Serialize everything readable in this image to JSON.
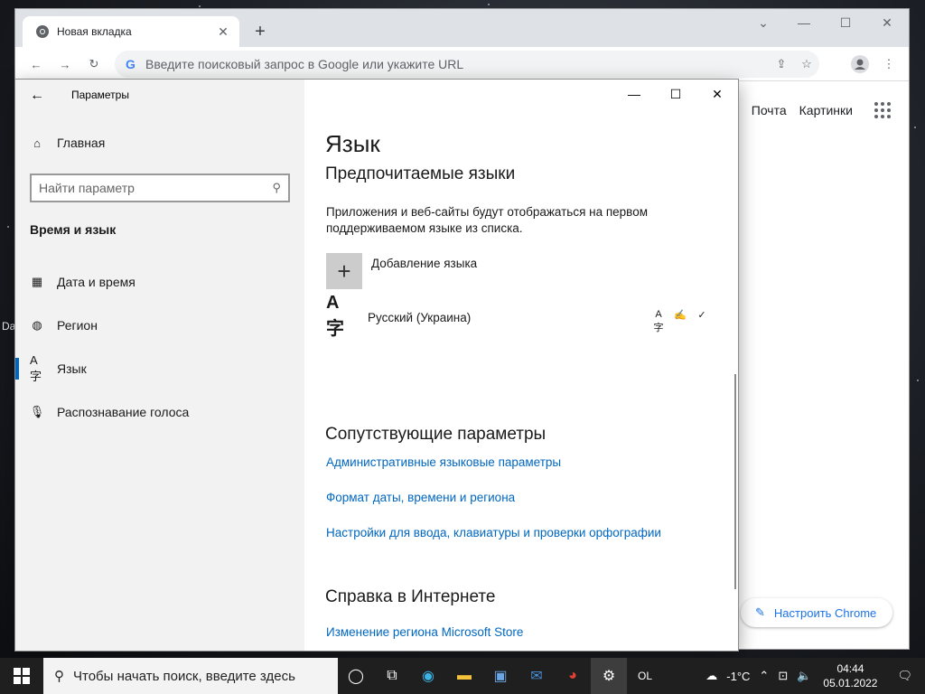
{
  "desktop": {
    "label": "Da"
  },
  "chrome": {
    "tab_title": "Новая вкладка",
    "omnibox_placeholder": "Введите поисковый запрос в Google или укажите URL",
    "links": [
      "Почта",
      "Картинки"
    ],
    "customize_label": "Настроить Chrome"
  },
  "settings": {
    "app_title": "Параметры",
    "home_label": "Главная",
    "search_placeholder": "Найти параметр",
    "section_title": "Время и язык",
    "nav": [
      {
        "label": "Дата и время",
        "icon": "clock-calendar-icon"
      },
      {
        "label": "Регион",
        "icon": "globe-icon"
      },
      {
        "label": "Язык",
        "icon": "language-icon"
      },
      {
        "label": "Распознавание голоса",
        "icon": "microphone-icon"
      }
    ],
    "active_nav_index": 2,
    "page_title": "Язык",
    "preferred_title": "Предпочитаемые языки",
    "description": "Приложения и веб-сайты будут отображаться на первом поддерживаемом языке из списка.",
    "add_language_label": "Добавление языка",
    "language": {
      "name": "Русский (Украина)"
    },
    "related_title": "Сопутствующие параметры",
    "related_links": [
      "Административные языковые параметры",
      "Формат даты, времени и региона",
      "Настройки для ввода, клавиатуры и проверки орфографии"
    ],
    "help_title": "Справка в Интернете",
    "help_links": [
      "Изменение региона Microsoft Store"
    ]
  },
  "taskbar": {
    "search_placeholder": "Чтобы начать поиск, введите здесь",
    "ime_label": "OL",
    "weather": "-1°C",
    "time": "04:44",
    "date": "05.01.2022"
  },
  "colors": {
    "accent": "#0067c0",
    "chrome_link": "#1a73e8",
    "taskbar": "#1f1f1f"
  }
}
